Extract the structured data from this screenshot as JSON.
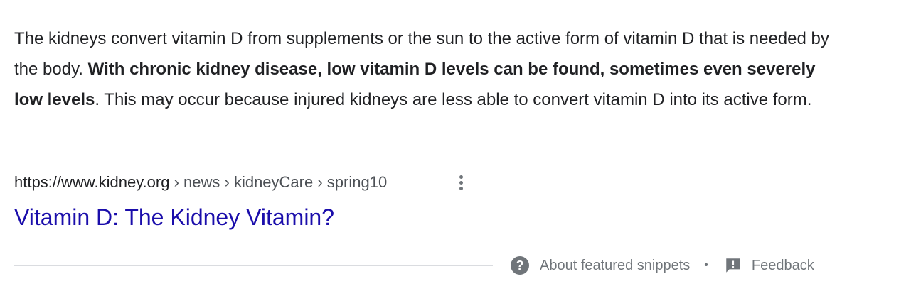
{
  "snippet": {
    "text_before": "The kidneys convert vitamin D from supplements or the sun to the active form of vitamin D that is needed by the body. ",
    "text_bold": "With chronic kidney disease, low vitamin D levels can be found, sometimes even severely low levels",
    "text_after": ". This may occur because injured kidneys are less able to convert vitamin D into its active form."
  },
  "citation": {
    "domain": "https://www.kidney.org",
    "sep1": " › ",
    "path1": "news",
    "sep2": " › ",
    "path2": "kidneyCare",
    "sep3": " › ",
    "path3": "spring10"
  },
  "result": {
    "title": "Vitamin D: The Kidney Vitamin?"
  },
  "footer": {
    "help_glyph": "?",
    "about_label": "About featured snippets",
    "separator": "•",
    "feedback_label": "Feedback"
  },
  "icons": {
    "more_options": "more-vert-icon",
    "help": "help-circle-icon",
    "feedback": "feedback-icon"
  },
  "colors": {
    "link": "#1a0dab",
    "text": "#202124",
    "muted": "#70757a",
    "divider": "#dadce0"
  }
}
